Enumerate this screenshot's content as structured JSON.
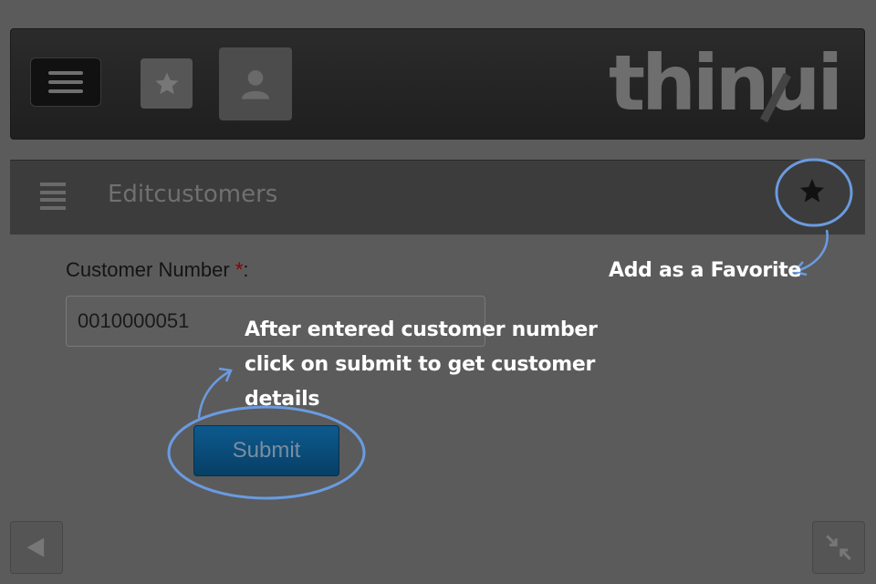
{
  "header": {
    "logo_text": "thinui",
    "menu_icon": "hamburger-icon",
    "favorites_icon": "star-icon",
    "user_icon": "user-icon"
  },
  "panel": {
    "title": "Editcustomers",
    "list_icon": "list-icon",
    "favorite_icon": "star-icon"
  },
  "form": {
    "customer_number_label": "Customer Number",
    "required_marker": "*",
    "label_suffix": ":",
    "customer_number_value": "0010000051",
    "submit_label": "Submit"
  },
  "annotations": {
    "favorite_hint": "Add as a Favorite",
    "submit_hint": "After entered customer number click on submit to get customer details"
  },
  "footer": {
    "back_icon": "triangle-left-icon",
    "shrink_icon": "shrink-arrows-icon"
  },
  "colors": {
    "highlight_circle": "#6a9be0",
    "submit_bg": "#0a4a78",
    "required": "#8b0000"
  }
}
